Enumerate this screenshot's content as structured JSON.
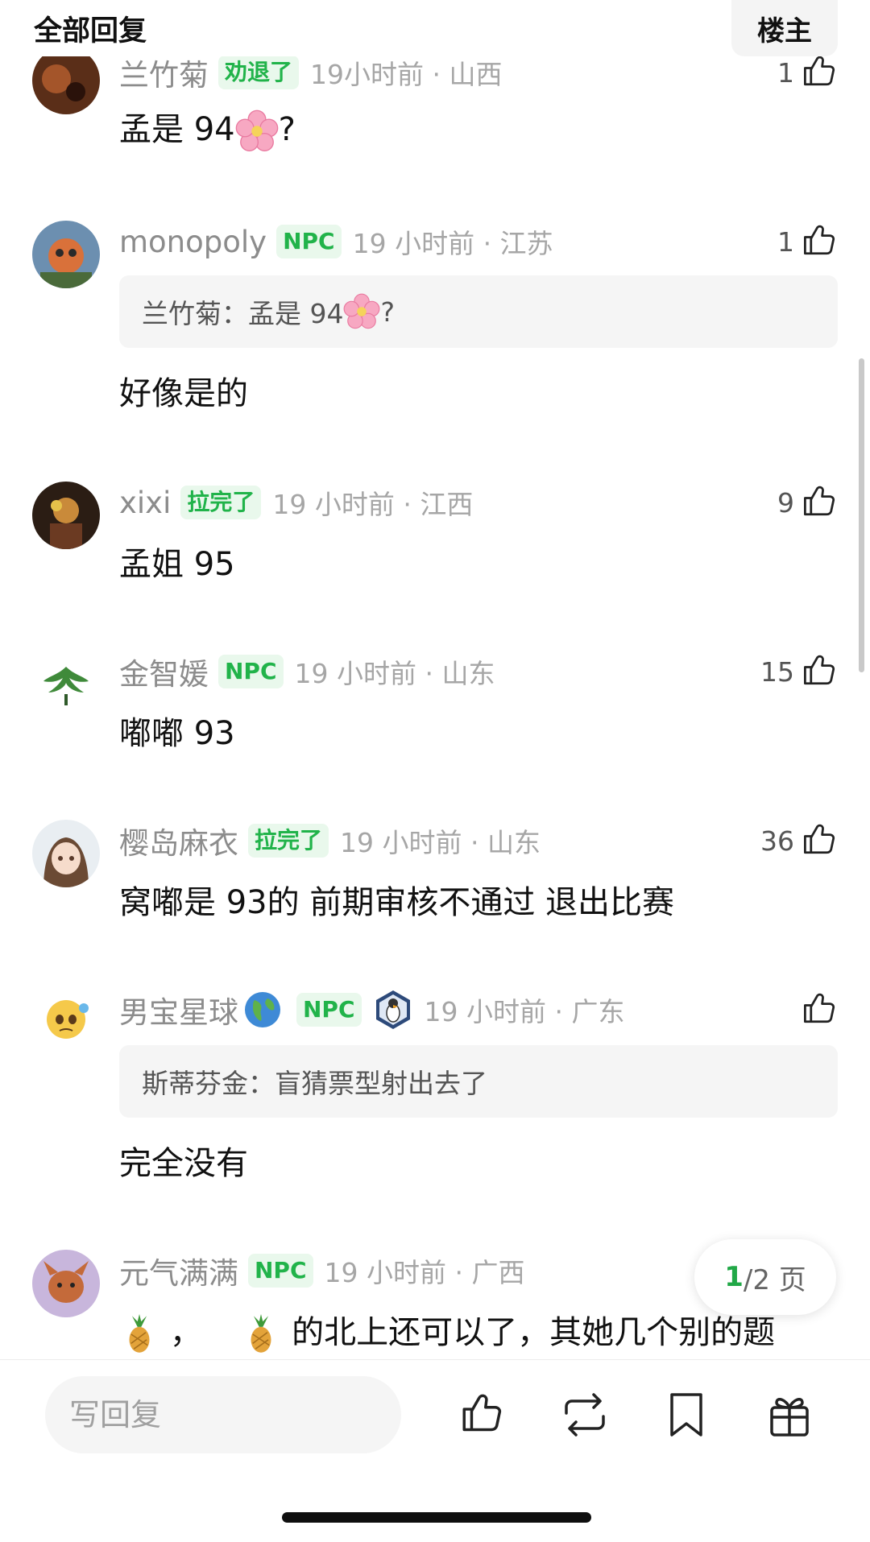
{
  "header": {
    "title": "全部回复",
    "owner_label": "楼主"
  },
  "comments": [
    {
      "username": "兰竹菊",
      "badge": "劝退了",
      "time": "19小时前 · 山西",
      "likes": "1",
      "text": "孟是 94",
      "text_suffix": "?"
    },
    {
      "username": "monopoly",
      "badge": "NPC",
      "time": "19 小时前 · 江苏",
      "likes": "1",
      "quote_prefix": "兰竹菊：孟是 94",
      "quote_suffix": "?",
      "text": "好像是的"
    },
    {
      "username": "xixi",
      "badge": "拉完了",
      "time": "19 小时前 · 江西",
      "likes": "9",
      "text": "孟姐 95"
    },
    {
      "username": "金智媛",
      "badge": "NPC",
      "time": "19 小时前 · 山东",
      "likes": "15",
      "text": "嘟嘟 93"
    },
    {
      "username": "樱岛麻衣",
      "badge": "拉完了",
      "time": "19 小时前 · 山东",
      "likes": "36",
      "text": "窝嘟是 93的 前期审核不通过 退出比赛"
    },
    {
      "username": "男宝星球",
      "badge": "NPC",
      "time": "19 小时前 · 广东",
      "likes": "",
      "quote": "斯蒂芬金：盲猜票型射出去了",
      "text": "完全没有"
    },
    {
      "username": "元气满满",
      "badge": "NPC",
      "time": "19 小时前 · 广西",
      "likes": "",
      "text_sep": "，",
      "text": "的北上还可以了，其她几个别的题"
    }
  ],
  "pager": {
    "current": "1",
    "total": "/2 页"
  },
  "bottom_bar": {
    "reply_placeholder": "写回复"
  },
  "colors": {
    "accent_green": "#21b34a",
    "badge_bg": "#e9f8ec",
    "quote_bg": "#f5f5f5"
  },
  "icons": [
    "thumb-up-icon",
    "repost-icon",
    "bookmark-icon",
    "gift-icon",
    "globe-emoji-icon",
    "pineapple-emoji-icon",
    "cherry-blossom-emoji-icon",
    "penguin-badge-icon"
  ]
}
